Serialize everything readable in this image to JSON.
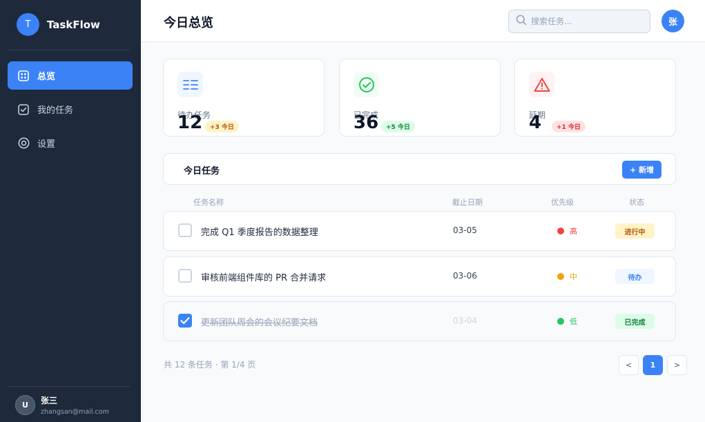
{
  "app": {
    "logo_letter": "T",
    "name": "TaskFlow"
  },
  "nav": [
    {
      "label": "总览",
      "icon": "dashboard-icon",
      "active": true
    },
    {
      "label": "我的任务",
      "icon": "checkbox-icon",
      "active": false
    },
    {
      "label": "设置",
      "icon": "settings-icon",
      "active": false
    }
  ],
  "user": {
    "avatar": "U",
    "name": "张三",
    "email": "zhangsan@mail.com"
  },
  "header": {
    "title": "今日总览",
    "search_placeholder": "搜索任务...",
    "avatar": "张"
  },
  "stats": [
    {
      "label": "待办任务",
      "value": "12",
      "badge": "+3 今日",
      "icon": "list-icon",
      "color": "#3b82f6"
    },
    {
      "label": "已完成",
      "value": "36",
      "badge": "+5 今日",
      "icon": "check-circle-icon",
      "color": "#22c55e"
    },
    {
      "label": "延期",
      "value": "4",
      "badge": "+1 今日",
      "icon": "warning-icon",
      "color": "#ef4444"
    }
  ],
  "tasks_panel": {
    "title": "今日任务",
    "add_label": "+ 新增",
    "columns": {
      "name": "任务名称",
      "due": "截止日期",
      "priority": "优先级",
      "status": "状态"
    },
    "rows": [
      {
        "name": "完成 Q1 季度报告的数据整理",
        "due": "03-05",
        "priority": "高",
        "priority_color": "#ef4444",
        "status": "进行中",
        "done": false
      },
      {
        "name": "审核前端组件库的 PR 合并请求",
        "due": "03-06",
        "priority": "中",
        "priority_color": "#f59e0b",
        "status": "待办",
        "done": false
      },
      {
        "name": "更新团队周会的会议纪要文档",
        "due": "03-04",
        "priority": "低",
        "priority_color": "#22c55e",
        "status": "已完成",
        "done": true
      }
    ]
  },
  "pagination": {
    "summary": "共 12 条任务 · 第 1/4 页",
    "prev": "<",
    "current": "1",
    "next": ">"
  }
}
